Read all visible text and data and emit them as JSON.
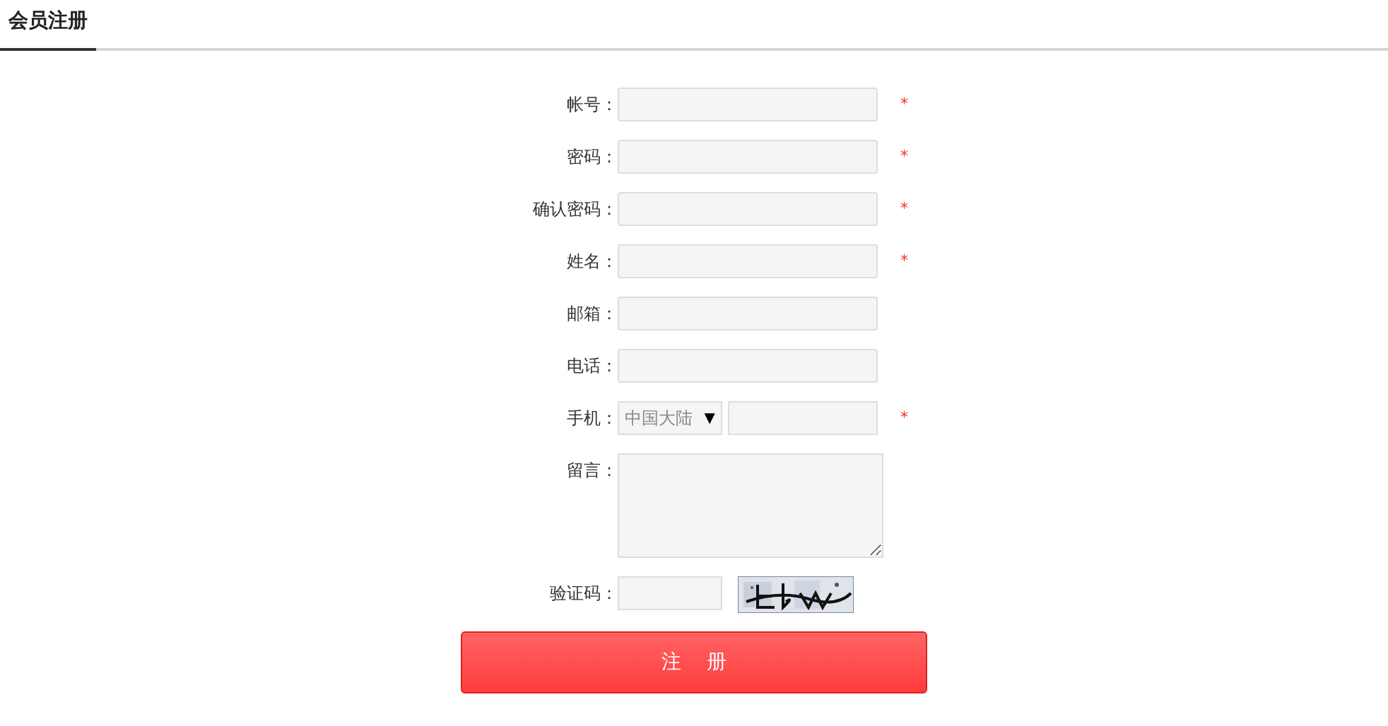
{
  "tabs": [
    {
      "label": "会员注册",
      "selected": true
    }
  ],
  "fields": [
    {
      "kind": "text",
      "label": "帐号：",
      "required": true
    },
    {
      "kind": "text",
      "label": "密码：",
      "required": true
    },
    {
      "kind": "text",
      "label": "确认密码：",
      "required": true
    },
    {
      "kind": "text",
      "label": "姓名：",
      "required": true
    },
    {
      "kind": "text",
      "label": "邮箱：",
      "required": false
    },
    {
      "kind": "text",
      "label": "电话：",
      "required": false
    },
    {
      "kind": "phone",
      "label": "手机：",
      "required": true,
      "region": "中国大陆"
    },
    {
      "kind": "textarea",
      "label": "留言：",
      "required": false
    },
    {
      "kind": "captcha",
      "label": "验证码：",
      "required": false
    }
  ],
  "required_mark": "*",
  "dropdown_arrow": "▼",
  "submit": "注 册"
}
